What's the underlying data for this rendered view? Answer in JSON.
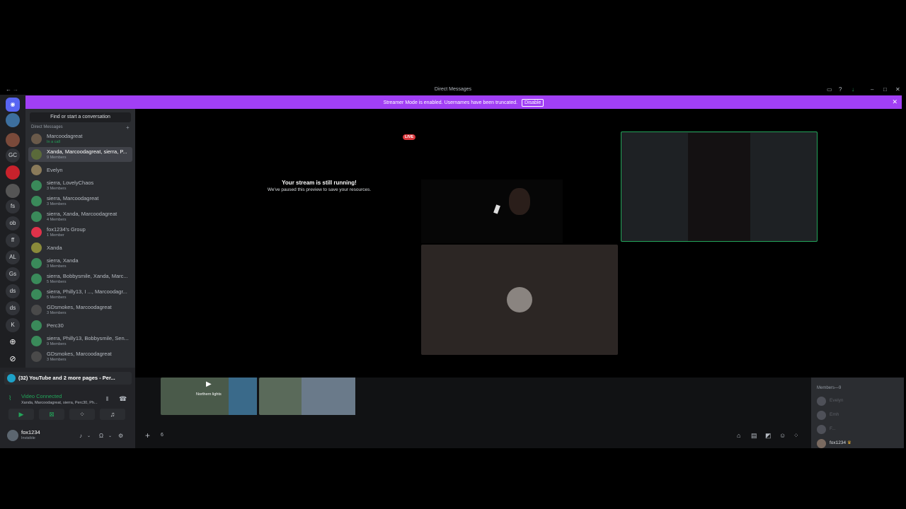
{
  "window": {
    "title": "Direct Messages"
  },
  "banner": {
    "text": "Streamer Mode is enabled. Usernames have been truncated.",
    "button": "Disable"
  },
  "guilds": [
    "GC",
    "fs",
    "ob",
    "ff",
    "AL",
    "Gs",
    "ds",
    "ds",
    "K"
  ],
  "dm": {
    "search": "Find or start a conversation",
    "header": "Direct Messages",
    "items": [
      {
        "name": "Marcoodagreat",
        "sub": "In a call"
      },
      {
        "name": "Xanda, Marcoodagreat, sierra, P...",
        "sub": "9 Members"
      },
      {
        "name": "Evelyn",
        "sub": ""
      },
      {
        "name": "sierra, LovelyChaos",
        "sub": "3 Members"
      },
      {
        "name": "sierra, Marcoodagreat",
        "sub": "3 Members"
      },
      {
        "name": "sierra, Xanda, Marcoodagreat",
        "sub": "4 Members"
      },
      {
        "name": "fox1234's Group",
        "sub": "1 Member"
      },
      {
        "name": "Xanda",
        "sub": ""
      },
      {
        "name": "sierra, Xanda",
        "sub": "3 Members"
      },
      {
        "name": "sierra, Bobbysmile, Xanda, Marc...",
        "sub": "5 Members"
      },
      {
        "name": "sierra, Philly13, I ..., Marcoodagr...",
        "sub": "5 Members"
      },
      {
        "name": "GDsmokes, Marcoodagreat",
        "sub": "3 Members"
      },
      {
        "name": "Perc30",
        "sub": ""
      },
      {
        "name": "sierra, Philly13, Bobbysmile, Sen...",
        "sub": "9 Members"
      },
      {
        "name": "GDsmokes, Marcoodagreat",
        "sub": "3 Members"
      }
    ]
  },
  "panel": {
    "activity": "(32) YouTube and 2 more pages - Per...",
    "voice_status": "Video Connected",
    "voice_members": "Xanda, Marcoodagreat, sierra, Perc30, Ph...",
    "username": "fox1234",
    "status": "Invisible"
  },
  "stage": {
    "live": "LIVE",
    "paused_title": "Your stream is still running!",
    "paused_sub": "We've paused this preview to save your resources."
  },
  "thumb": {
    "label": "Northern lights"
  },
  "chat": {
    "counter": "6"
  },
  "members": {
    "header": "Members—9",
    "list": [
      "Evelyn",
      "Emh",
      "F...",
      "fox1234"
    ]
  }
}
